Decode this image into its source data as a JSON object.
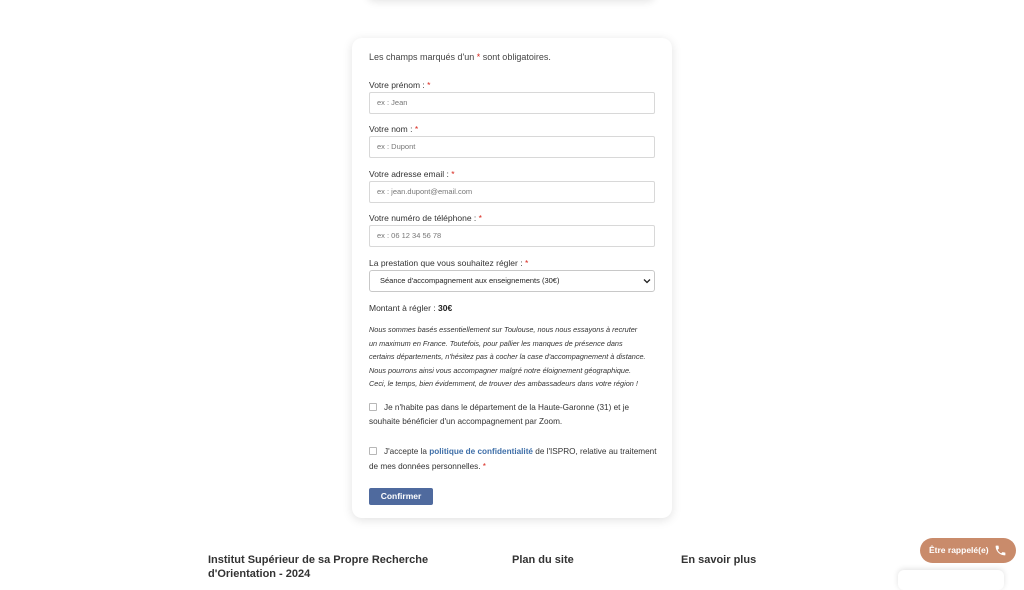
{
  "form": {
    "intro_before": "Les champs marqués d'un ",
    "intro_star": "*",
    "intro_after": " sont obligatoires.",
    "required_marker": "*",
    "firstname": {
      "label": "Votre prénom :",
      "placeholder": "ex : Jean"
    },
    "lastname": {
      "label": "Votre nom :",
      "placeholder": "ex : Dupont"
    },
    "email": {
      "label": "Votre adresse email :",
      "placeholder": "ex : jean.dupont@email.com"
    },
    "phone": {
      "label": "Votre numéro de téléphone :",
      "placeholder": "ex : 06 12 34 56 78"
    },
    "service": {
      "label": "La prestation que vous souhaitez régler :",
      "selected": "Séance d'accompagnement aux enseignements (30€)"
    },
    "amount": {
      "label": "Montant à régler :",
      "value": "30€"
    },
    "note_lines": [
      "Nous sommes basés essentiellement sur Toulouse, nous nous essayons à recruter",
      "un maximum en France. Toutefois, pour pallier les manques de présence dans",
      "certains départements, n'hésitez pas à cocher la case d'accompagnement à distance.",
      "Nous pourrons ainsi vous accompagner malgré notre éloignement géographique.",
      "Ceci, le temps, bien évidemment, de trouver des ambassadeurs dans votre région !"
    ],
    "zoom_checkbox": {
      "line1": "Je n'habite pas dans le département de la Haute-Garonne (31) et je",
      "line2": "souhaite bénéficier d'un accompagnement par Zoom."
    },
    "privacy_checkbox": {
      "before": "J'accepte la ",
      "link": "politique de confidentialité",
      "after": " de l'ISPRO, relative au traitement",
      "line2": "de mes données personnelles.",
      "star": "*"
    },
    "submit_label": "Confirmer"
  },
  "footer": {
    "col1_title": "Institut Supérieur de sa Propre Recherche",
    "col1_title_line2": "d'Orientation - 2024",
    "col2_title": "Plan du site",
    "col3_title": "En savoir plus"
  },
  "callback_button": {
    "label": "Être rappelé(e)",
    "icon": "phone-icon"
  },
  "colors": {
    "accent_button": "#4f6a9e",
    "required_star": "#d9281e",
    "link": "#3f6fa8",
    "callback": "#c98b6b"
  }
}
